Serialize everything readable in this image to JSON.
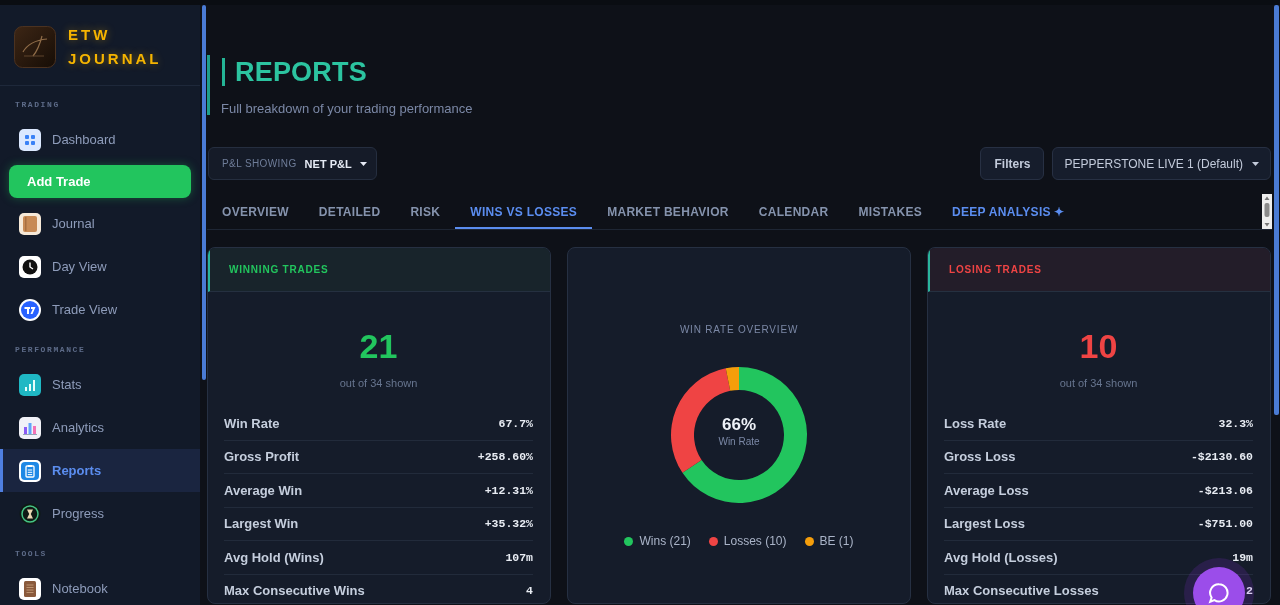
{
  "sidebar": {
    "brand": {
      "line_1": "ETW",
      "line_2": "JOURNAL"
    },
    "sections": [
      {
        "label": "TRADING",
        "items": [
          {
            "kind": "link",
            "label": "Dashboard",
            "selected": false
          },
          {
            "kind": "button",
            "label": "Add Trade",
            "selected": false
          },
          {
            "kind": "link",
            "label": "Journal",
            "selected": false
          },
          {
            "kind": "link",
            "label": "Day View",
            "selected": false
          },
          {
            "kind": "link",
            "label": "Trade View",
            "selected": false
          }
        ]
      },
      {
        "label": "PERFORMANCE",
        "items": [
          {
            "kind": "link",
            "label": "Stats",
            "selected": false
          },
          {
            "kind": "link",
            "label": "Analytics",
            "selected": false
          },
          {
            "kind": "link",
            "label": "Reports",
            "selected": true
          },
          {
            "kind": "link",
            "label": "Progress",
            "selected": false
          }
        ]
      },
      {
        "label": "TOOLS",
        "items": [
          {
            "kind": "link",
            "label": "Notebook",
            "selected": false
          }
        ]
      }
    ]
  },
  "header": {
    "title": "REPORTS",
    "subtitle": "Full breakdown of your trading performance"
  },
  "toolbar": {
    "pnl_select": {
      "label": "P&L SHOWING",
      "value": "NET P&L"
    },
    "filters_button": "Filters",
    "account_select": {
      "value": "PEPPERSTONE LIVE 1 (Default)"
    }
  },
  "tabs": [
    {
      "label": "OVERVIEW",
      "selected": false,
      "highlighted": false
    },
    {
      "label": "DETAILED",
      "selected": false,
      "highlighted": false
    },
    {
      "label": "RISK",
      "selected": false,
      "highlighted": false
    },
    {
      "label": "WINS VS LOSSES",
      "selected": true,
      "highlighted": false
    },
    {
      "label": "MARKET BEHAVIOR",
      "selected": false,
      "highlighted": false
    },
    {
      "label": "CALENDAR",
      "selected": false,
      "highlighted": false
    },
    {
      "label": "MISTAKES",
      "selected": false,
      "highlighted": false
    },
    {
      "label": "DEEP ANALYSIS ✦",
      "selected": false,
      "highlighted": true
    }
  ],
  "cards": [
    {
      "kind": "winning",
      "title": "WINNING TRADES",
      "count": "21",
      "caption": "out of 34 shown",
      "stats": [
        {
          "label": "Win Rate",
          "value": "67.7%"
        },
        {
          "label": "Gross Profit",
          "value": "+258.60%"
        },
        {
          "label": "Average Win",
          "value": "+12.31%"
        },
        {
          "label": "Largest Win",
          "value": "+35.32%"
        },
        {
          "label": "Avg Hold (Wins)",
          "value": "107m"
        },
        {
          "label": "Max Consecutive Wins",
          "value": "4"
        }
      ]
    },
    {
      "kind": "overview",
      "center_value": "66%",
      "center_label": "Win Rate",
      "chart_data": {
        "type": "donut",
        "title": "WIN RATE OVERVIEW",
        "categories": [
          "Wins (21)",
          "Losses (10)",
          "BE (1)"
        ],
        "values": [
          21,
          10,
          1
        ],
        "colors": [
          "#22c55e",
          "#ef4444",
          "#f59e0b"
        ]
      }
    },
    {
      "kind": "losing",
      "title": "LOSING TRADES",
      "count": "10",
      "caption": "out of 34 shown",
      "stats": [
        {
          "label": "Loss Rate",
          "value": "32.3%"
        },
        {
          "label": "Gross Loss",
          "value": "-$2130.60"
        },
        {
          "label": "Average Loss",
          "value": "-$213.06"
        },
        {
          "label": "Largest Loss",
          "value": "-$751.00"
        },
        {
          "label": "Avg Hold (Losses)",
          "value": "19m"
        },
        {
          "label": "Max Consecutive Losses",
          "value": "2"
        }
      ]
    }
  ]
}
